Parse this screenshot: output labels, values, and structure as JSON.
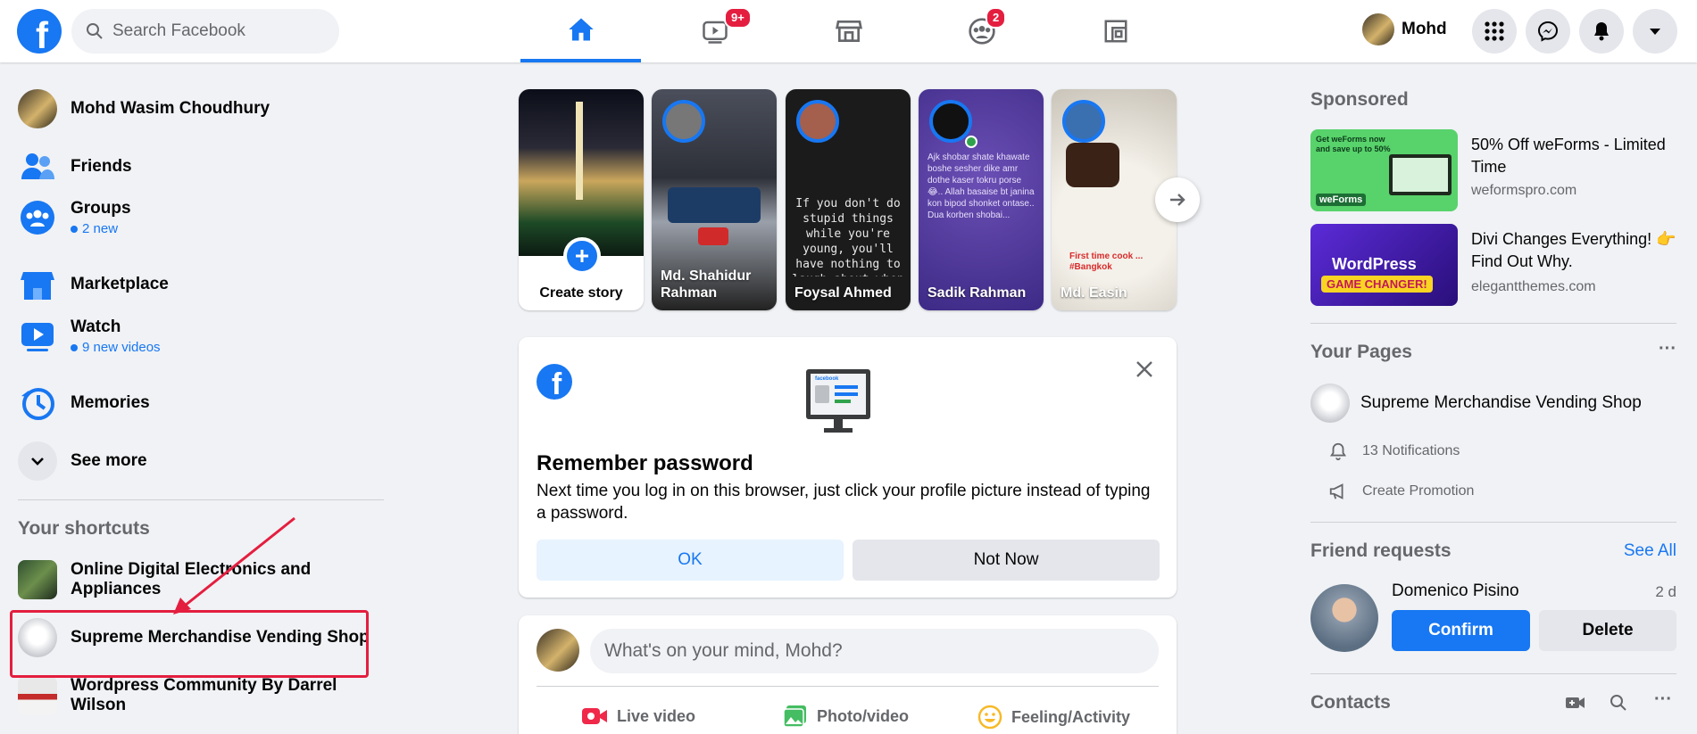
{
  "topbar": {
    "logo": "f",
    "search_placeholder": "Search Facebook",
    "nav": [
      {
        "name": "home",
        "badge": ""
      },
      {
        "name": "watch",
        "badge": "9+"
      },
      {
        "name": "marketplace",
        "badge": ""
      },
      {
        "name": "groups",
        "badge": "2"
      },
      {
        "name": "gaming",
        "badge": ""
      }
    ],
    "profile_name": "Mohd"
  },
  "left_sidebar": {
    "profile_name": "Mohd Wasim Choudhury",
    "items": [
      {
        "label": "Friends",
        "sub": ""
      },
      {
        "label": "Groups",
        "sub": "2 new"
      },
      {
        "label": "Marketplace",
        "sub": ""
      },
      {
        "label": "Watch",
        "sub": "9 new videos"
      },
      {
        "label": "Memories",
        "sub": ""
      },
      {
        "label": "See more",
        "sub": ""
      }
    ],
    "shortcuts_title": "Your shortcuts",
    "shortcuts": [
      "Online Digital Electronics and Appliances",
      "Supreme Merchandise Vending Shop",
      "Wordpress Community By Darrel Wilson"
    ]
  },
  "stories": [
    {
      "name": "Create story"
    },
    {
      "name": "Md. Shahidur Rahman",
      "text": ""
    },
    {
      "name": "Foysal Ahmed",
      "text": "If you don't do stupid things while you're young, you'll have nothing to laugh about when you're old."
    },
    {
      "name": "Sadik Rahman",
      "text": "Ajk shobar shate khawate boshe sesher dike amr dothe kaser tokru porse 😂.. Allah basaise bt janina kon bipod shonket ontase.. Dua korben shobai..."
    },
    {
      "name": "Md. Easin",
      "text": "First time cook ... #Bangkok"
    }
  ],
  "remember_card": {
    "title": "Remember password",
    "body": "Next time you log in on this browser, just click your profile picture instead of typing a password.",
    "ok": "OK",
    "not_now": "Not Now",
    "illustration_text": "facebook"
  },
  "composer": {
    "placeholder": "What's on your mind, Mohd?",
    "actions": [
      "Live video",
      "Photo/video",
      "Feeling/Activity"
    ]
  },
  "right_sidebar": {
    "sponsored_title": "Sponsored",
    "ads": [
      {
        "title": "50% Off weForms - Limited Time",
        "url": "weformspro.com",
        "img_text": "Get weForms now and save up to 50%",
        "brand": "weForms"
      },
      {
        "title": "Divi Changes Everything! 👉 Find Out Why.",
        "url": "elegantthemes.com",
        "img_text": "WordPress",
        "img_text2": "GAME CHANGER!"
      }
    ],
    "pages_title": "Your Pages",
    "page_name": "Supreme Merchandise Vending Shop",
    "notifications": "13 Notifications",
    "create_promotion": "Create Promotion",
    "friend_requests_title": "Friend requests",
    "see_all": "See All",
    "request": {
      "name": "Domenico Pisino",
      "time": "2 d",
      "confirm": "Confirm",
      "delete": "Delete"
    },
    "contacts_title": "Contacts"
  },
  "colors": {
    "brand": "#1877f2",
    "badge": "#e41e3f",
    "annotation": "#e41e3f"
  }
}
